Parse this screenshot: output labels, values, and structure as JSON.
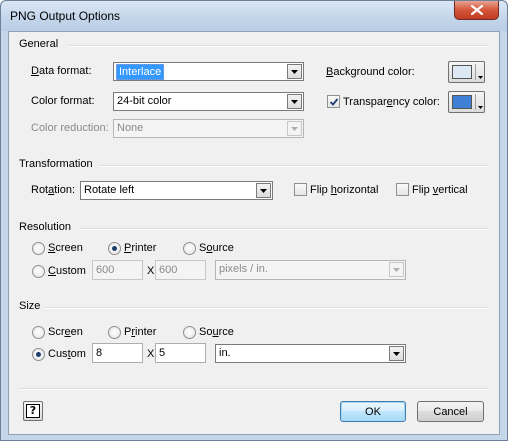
{
  "window": {
    "title": "PNG Output Options"
  },
  "general": {
    "title": "General",
    "data_format": {
      "label": "Data format:",
      "value": "Interlace"
    },
    "color_format": {
      "label": "Color format:",
      "value": "24-bit color"
    },
    "color_reduction": {
      "label": "Color reduction:",
      "value": "None"
    },
    "background_color": {
      "label": "Background color:",
      "color": "#dde8f5"
    },
    "transparency": {
      "label": "Transparency color:",
      "checked": true,
      "color": "#3f7fd4"
    }
  },
  "transformation": {
    "title": "Transformation",
    "rotation": {
      "label": "Rotation:",
      "value": "Rotate left"
    },
    "flip_horizontal": {
      "label": "Flip horizontal",
      "checked": false
    },
    "flip_vertical": {
      "label": "Flip vertical",
      "checked": false
    }
  },
  "resolution": {
    "title": "Resolution",
    "options": [
      "Screen",
      "Printer",
      "Source",
      "Custom"
    ],
    "selected": "Printer",
    "width": "600",
    "x": "X",
    "height": "600",
    "units": "pixels / in."
  },
  "size": {
    "title": "Size",
    "options": [
      "Screen",
      "Printer",
      "Source",
      "Custom"
    ],
    "selected": "Custom",
    "width": "8",
    "x": "X",
    "height": "5",
    "units": "in."
  },
  "buttons": {
    "help": "?",
    "ok": "OK",
    "cancel": "Cancel"
  }
}
